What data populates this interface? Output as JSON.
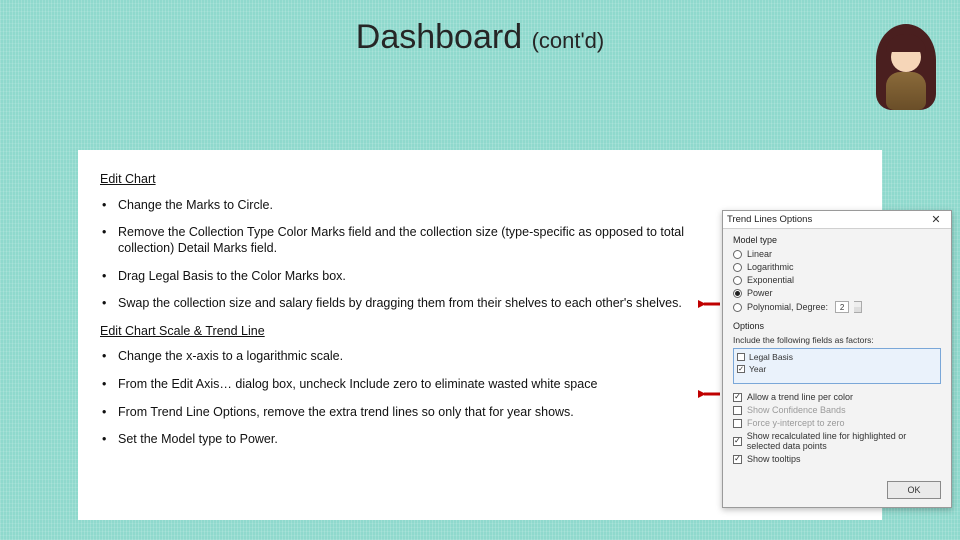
{
  "title": {
    "main": "Dashboard",
    "suffix": "(cont'd)"
  },
  "sections": {
    "edit_chart_heading": "Edit Chart",
    "edit_chart_items": [
      "Change the Marks to Circle.",
      "Remove the Collection Type Color Marks field and the collection size (type-specific as opposed to total collection) Detail Marks field.",
      "Drag Legal Basis to the Color Marks box.",
      "Swap the collection size and salary fields by dragging them from their shelves to each other's shelves."
    ],
    "scale_heading": "Edit Chart Scale & Trend Line",
    "scale_items": [
      "Change the x-axis to a logarithmic scale.",
      "From the Edit Axis… dialog box, uncheck Include zero to eliminate wasted white space",
      "From Trend Line Options, remove the extra trend lines so only that for year shows.",
      "Set the Model type to Power."
    ]
  },
  "dialog": {
    "title": "Trend Lines Options",
    "close_glyph": "✕",
    "model_type_label": "Model type",
    "models": {
      "linear": "Linear",
      "logarithmic": "Logarithmic",
      "exponential": "Exponential",
      "power": "Power",
      "polynomial": "Polynomial, Degree:",
      "degree_value": "2"
    },
    "options_label": "Options",
    "factors_label": "Include the following fields as factors:",
    "factors": {
      "f1": "Legal Basis",
      "f2": "Year"
    },
    "checks": {
      "allow_color": "Allow a trend line per color",
      "confidence": "Show Confidence Bands",
      "force_zero": "Force y-intercept to zero",
      "recalc": "Show recalculated line for highlighted or selected data points",
      "tooltips": "Show tooltips"
    },
    "ok": "OK"
  }
}
